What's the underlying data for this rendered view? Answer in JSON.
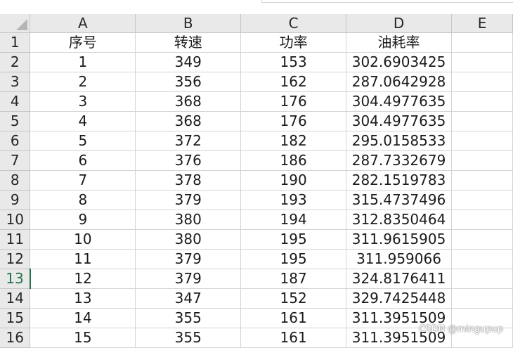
{
  "sheet": {
    "columns": [
      "A",
      "B",
      "C",
      "D",
      "E"
    ],
    "rows": [
      {
        "num": "1",
        "cells": [
          "序号",
          "转速",
          "功率",
          "油耗率",
          ""
        ]
      },
      {
        "num": "2",
        "cells": [
          "1",
          "349",
          "153",
          "302.6903425",
          ""
        ]
      },
      {
        "num": "3",
        "cells": [
          "2",
          "356",
          "162",
          "287.0642928",
          ""
        ]
      },
      {
        "num": "4",
        "cells": [
          "3",
          "368",
          "176",
          "304.4977635",
          ""
        ]
      },
      {
        "num": "5",
        "cells": [
          "4",
          "368",
          "176",
          "304.4977635",
          ""
        ]
      },
      {
        "num": "6",
        "cells": [
          "5",
          "372",
          "182",
          "295.0158533",
          ""
        ]
      },
      {
        "num": "7",
        "cells": [
          "6",
          "376",
          "186",
          "287.7332679",
          ""
        ]
      },
      {
        "num": "8",
        "cells": [
          "7",
          "378",
          "190",
          "282.1519783",
          ""
        ]
      },
      {
        "num": "9",
        "cells": [
          "8",
          "379",
          "193",
          "315.4737496",
          ""
        ]
      },
      {
        "num": "10",
        "cells": [
          "9",
          "380",
          "194",
          "312.8350464",
          ""
        ]
      },
      {
        "num": "11",
        "cells": [
          "10",
          "380",
          "195",
          "311.9615905",
          ""
        ]
      },
      {
        "num": "12",
        "cells": [
          "11",
          "379",
          "195",
          "311.959066",
          ""
        ]
      },
      {
        "num": "13",
        "cells": [
          "12",
          "379",
          "187",
          "324.8176411",
          ""
        ]
      },
      {
        "num": "14",
        "cells": [
          "13",
          "347",
          "152",
          "329.7425448",
          ""
        ]
      },
      {
        "num": "15",
        "cells": [
          "14",
          "355",
          "161",
          "311.3951509",
          ""
        ]
      },
      {
        "num": "16",
        "cells": [
          "15",
          "355",
          "161",
          "311.3951509",
          ""
        ]
      }
    ],
    "active_row": "13"
  },
  "watermark": "CSDN @mingupup",
  "colors": {
    "header_bg": "#e9e9e9",
    "grid": "#d4d4d4",
    "active_accent": "#217346"
  }
}
